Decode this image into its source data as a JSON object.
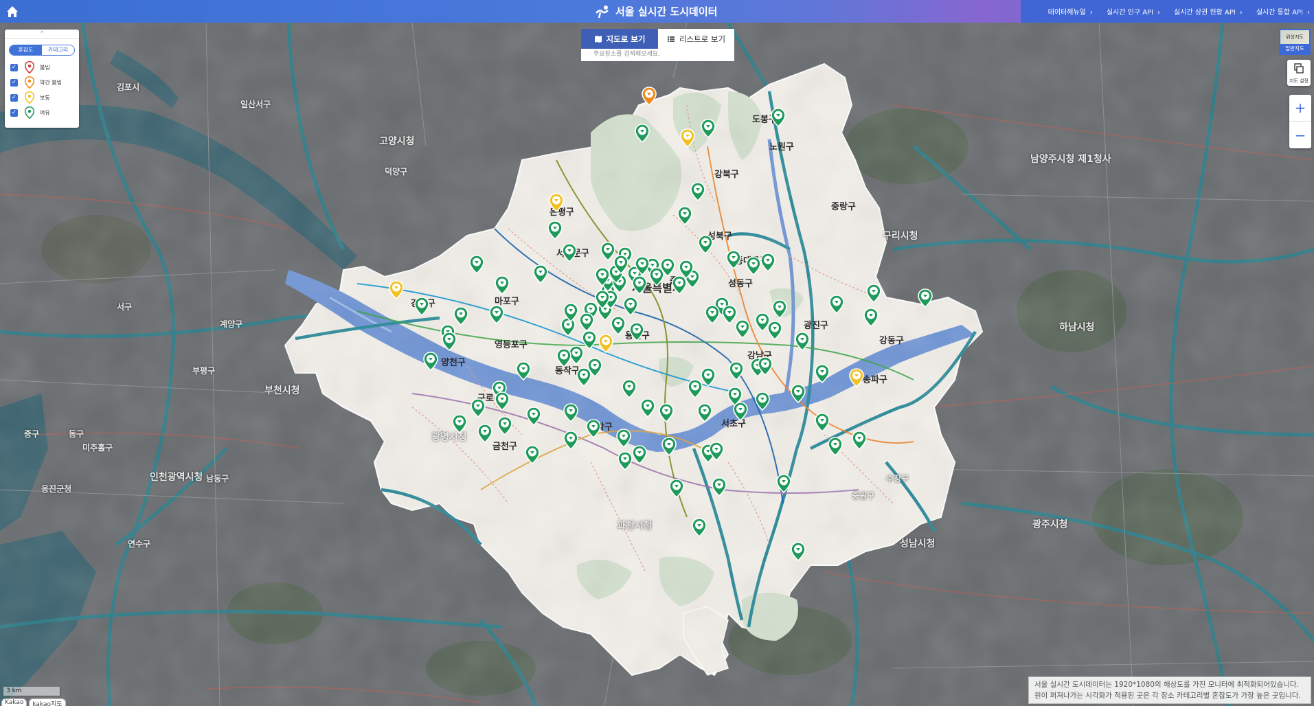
{
  "header": {
    "title": "서울 실시간 도시데이터",
    "nav": [
      {
        "label": "데이터해뉴얼"
      },
      {
        "label": "실시간 인구 API"
      },
      {
        "label": "실시간 상권 현황 API"
      },
      {
        "label": "실시간 통합 API"
      }
    ]
  },
  "legend": {
    "tab_congestion": "혼잡도",
    "tab_category": "카테고리",
    "levels": [
      {
        "label": "붐빔",
        "color": "#d63a3a"
      },
      {
        "label": "약간 붐빔",
        "color": "#f08a1c"
      },
      {
        "label": "보통",
        "color": "#f2c122"
      },
      {
        "label": "여유",
        "color": "#1f9a5a"
      }
    ]
  },
  "view": {
    "map_tab": "지도로 보기",
    "list_tab": "리스트로 보기",
    "search_hint": "주요장소를 검색해보세요."
  },
  "controls": {
    "maptype_thumb": "위성지도",
    "maptype_label": "일반지도",
    "cadastral_label": "지도 설정",
    "zoom_in": "+",
    "zoom_out": "−"
  },
  "scale": {
    "text": "3 km"
  },
  "provider": [
    "Kakao",
    "kakao지도"
  ],
  "notice": {
    "line1": "서울 실시간 도시데이터는 1920*1080의 해상도를 가진 모니터에 최적화되어있습니다.",
    "line2": "원이 퍼져나가는 시각화가 적용된 곳은 각 장소 카테고리별 혼잡도가 가장 높은 곳입니다."
  },
  "map_labels": {
    "district": [
      {
        "text": "도봉구"
      },
      {
        "text": "노원구"
      },
      {
        "text": "강북구"
      },
      {
        "text": "은평구"
      },
      {
        "text": "성북구"
      },
      {
        "text": "중랑구"
      },
      {
        "text": "서대문구"
      },
      {
        "text": "동대문구"
      },
      {
        "text": "종로구"
      },
      {
        "text": "서울특별시"
      },
      {
        "text": "성동구"
      },
      {
        "text": "광진구"
      },
      {
        "text": "강서구"
      },
      {
        "text": "마포구"
      },
      {
        "text": "용산구"
      },
      {
        "text": "영등포구"
      },
      {
        "text": "양천구"
      },
      {
        "text": "동작구"
      },
      {
        "text": "구로구"
      },
      {
        "text": "금천구"
      },
      {
        "text": "관악구"
      },
      {
        "text": "서초구"
      },
      {
        "text": "강남구"
      },
      {
        "text": "송파구"
      },
      {
        "text": "강동구"
      }
    ],
    "outside": [
      {
        "text": "고양시청"
      },
      {
        "text": "덕양구"
      },
      {
        "text": "일산서구"
      },
      {
        "text": "김포시"
      },
      {
        "text": "부천시청"
      },
      {
        "text": "광명시청"
      },
      {
        "text": "인천광역시청"
      },
      {
        "text": "과천시청"
      },
      {
        "text": "성남시청"
      },
      {
        "text": "하남시청"
      },
      {
        "text": "구리시청"
      },
      {
        "text": "남양주시청 제1청사"
      },
      {
        "text": "광주시청"
      },
      {
        "text": "수정구"
      },
      {
        "text": "중원구"
      },
      {
        "text": "계양구"
      },
      {
        "text": "부평구"
      },
      {
        "text": "서구"
      },
      {
        "text": "미추홀구"
      },
      {
        "text": "남동구"
      },
      {
        "text": "연수구"
      },
      {
        "text": "옹진군청"
      },
      {
        "text": "중구"
      },
      {
        "text": "동구"
      }
    ]
  },
  "pins": {
    "moderate": [
      {
        "lon": 127.0262,
        "lat": 37.6562
      },
      {
        "lon": 126.927,
        "lat": 37.6162
      },
      {
        "lon": 126.806,
        "lat": 37.562
      },
      {
        "lon": 126.9645,
        "lat": 37.529
      },
      {
        "lon": 127.154,
        "lat": 37.5075
      }
    ],
    "slightly_busy": [
      {
        "lon": 126.997,
        "lat": 37.682
      }
    ],
    "relaxed": [
      {
        "lon": 127.095,
        "lat": 37.669
      },
      {
        "lon": 127.042,
        "lat": 37.662
      },
      {
        "lon": 126.992,
        "lat": 37.659
      },
      {
        "lon": 127.034,
        "lat": 37.623
      },
      {
        "lon": 127.024,
        "lat": 37.608
      },
      {
        "lon": 127.0,
        "lat": 37.576
      },
      {
        "lon": 127.076,
        "lat": 37.577
      },
      {
        "lon": 127.087,
        "lat": 37.579
      },
      {
        "lon": 127.03,
        "lat": 37.569
      },
      {
        "lon": 126.915,
        "lat": 37.572
      },
      {
        "lon": 126.867,
        "lat": 37.578
      },
      {
        "lon": 126.825,
        "lat": 37.552
      },
      {
        "lon": 126.845,
        "lat": 37.535
      },
      {
        "lon": 126.886,
        "lat": 37.565
      },
      {
        "lon": 126.882,
        "lat": 37.547
      },
      {
        "lon": 126.855,
        "lat": 37.546
      },
      {
        "lon": 126.884,
        "lat": 37.5
      },
      {
        "lon": 126.936,
        "lat": 37.539
      },
      {
        "lon": 126.942,
        "lat": 37.5215
      },
      {
        "lon": 126.933,
        "lat": 37.52
      },
      {
        "lon": 126.902,
        "lat": 37.512
      },
      {
        "lon": 126.952,
        "lat": 37.531
      },
      {
        "lon": 126.966,
        "lat": 37.56
      },
      {
        "lon": 126.983,
        "lat": 37.552
      },
      {
        "lon": 126.966,
        "lat": 37.567
      },
      {
        "lon": 126.975,
        "lat": 37.566
      },
      {
        "lon": 126.962,
        "lat": 37.57
      },
      {
        "lon": 126.972,
        "lat": 37.572
      },
      {
        "lon": 126.986,
        "lat": 37.571
      },
      {
        "lon": 126.99,
        "lat": 37.565
      },
      {
        "lon": 126.979,
        "lat": 37.583
      },
      {
        "lon": 126.992,
        "lat": 37.577
      },
      {
        "lon": 127.003,
        "lat": 37.57
      },
      {
        "lon": 127.011,
        "lat": 37.576
      },
      {
        "lon": 127.02,
        "lat": 37.565
      },
      {
        "lon": 127.025,
        "lat": 37.575
      },
      {
        "lon": 126.964,
        "lat": 37.549
      },
      {
        "lon": 126.974,
        "lat": 37.54
      },
      {
        "lon": 126.988,
        "lat": 37.536
      },
      {
        "lon": 126.968,
        "lat": 37.556
      },
      {
        "lon": 126.962,
        "lat": 37.556
      },
      {
        "lon": 126.953,
        "lat": 37.549
      },
      {
        "lon": 126.938,
        "lat": 37.548
      },
      {
        "lon": 126.95,
        "lat": 37.542
      },
      {
        "lon": 126.976,
        "lat": 37.578
      },
      {
        "lon": 126.966,
        "lat": 37.586
      },
      {
        "lon": 126.937,
        "lat": 37.585
      },
      {
        "lon": 126.926,
        "lat": 37.599
      },
      {
        "lon": 127.04,
        "lat": 37.59
      },
      {
        "lon": 127.061,
        "lat": 37.581
      },
      {
        "lon": 127.052,
        "lat": 37.552
      },
      {
        "lon": 127.068,
        "lat": 37.538
      },
      {
        "lon": 127.083,
        "lat": 37.542
      },
      {
        "lon": 127.045,
        "lat": 37.547
      },
      {
        "lon": 127.058,
        "lat": 37.547
      },
      {
        "lon": 127.096,
        "lat": 37.55
      },
      {
        "lon": 127.092,
        "lat": 37.537
      },
      {
        "lon": 127.139,
        "lat": 37.553
      },
      {
        "lon": 127.167,
        "lat": 37.56
      },
      {
        "lon": 127.206,
        "lat": 37.557
      },
      {
        "lon": 127.165,
        "lat": 37.545
      },
      {
        "lon": 127.113,
        "lat": 37.53
      },
      {
        "lon": 127.128,
        "lat": 37.51
      },
      {
        "lon": 127.063,
        "lat": 37.512
      },
      {
        "lon": 127.079,
        "lat": 37.514
      },
      {
        "lon": 127.085,
        "lat": 37.515
      },
      {
        "lon": 127.042,
        "lat": 37.508
      },
      {
        "lon": 127.032,
        "lat": 37.501
      },
      {
        "lon": 127.062,
        "lat": 37.496
      },
      {
        "lon": 127.039,
        "lat": 37.486
      },
      {
        "lon": 127.066,
        "lat": 37.487
      },
      {
        "lon": 127.083,
        "lat": 37.493
      },
      {
        "lon": 127.11,
        "lat": 37.498
      },
      {
        "lon": 127.128,
        "lat": 37.48
      },
      {
        "lon": 127.138,
        "lat": 37.465
      },
      {
        "lon": 126.956,
        "lat": 37.514
      },
      {
        "lon": 126.948,
        "lat": 37.508
      },
      {
        "lon": 126.982,
        "lat": 37.501
      },
      {
        "lon": 126.996,
        "lat": 37.489
      },
      {
        "lon": 127.01,
        "lat": 37.486
      },
      {
        "lon": 126.978,
        "lat": 37.47
      },
      {
        "lon": 126.979,
        "lat": 37.456
      },
      {
        "lon": 126.955,
        "lat": 37.476
      },
      {
        "lon": 126.91,
        "lat": 37.484
      },
      {
        "lon": 126.886,
        "lat": 37.493
      },
      {
        "lon": 126.868,
        "lat": 37.489
      },
      {
        "lon": 126.888,
        "lat": 37.478
      },
      {
        "lon": 126.873,
        "lat": 37.473
      },
      {
        "lon": 126.854,
        "lat": 37.479
      },
      {
        "lon": 126.909,
        "lat": 37.46
      },
      {
        "lon": 126.938,
        "lat": 37.469
      },
      {
        "lon": 126.938,
        "lat": 37.486
      },
      {
        "lon": 127.012,
        "lat": 37.465
      },
      {
        "lon": 127.042,
        "lat": 37.461
      },
      {
        "lon": 127.099,
        "lat": 37.442
      },
      {
        "lon": 127.05,
        "lat": 37.44
      },
      {
        "lon": 127.048,
        "lat": 37.462
      },
      {
        "lon": 127.156,
        "lat": 37.469
      },
      {
        "lon": 127.018,
        "lat": 37.439
      },
      {
        "lon": 126.99,
        "lat": 37.46
      },
      {
        "lon": 126.832,
        "lat": 37.518
      },
      {
        "lon": 126.846,
        "lat": 37.53
      },
      {
        "lon": 127.11,
        "lat": 37.4
      },
      {
        "lon": 127.035,
        "lat": 37.415
      }
    ]
  }
}
